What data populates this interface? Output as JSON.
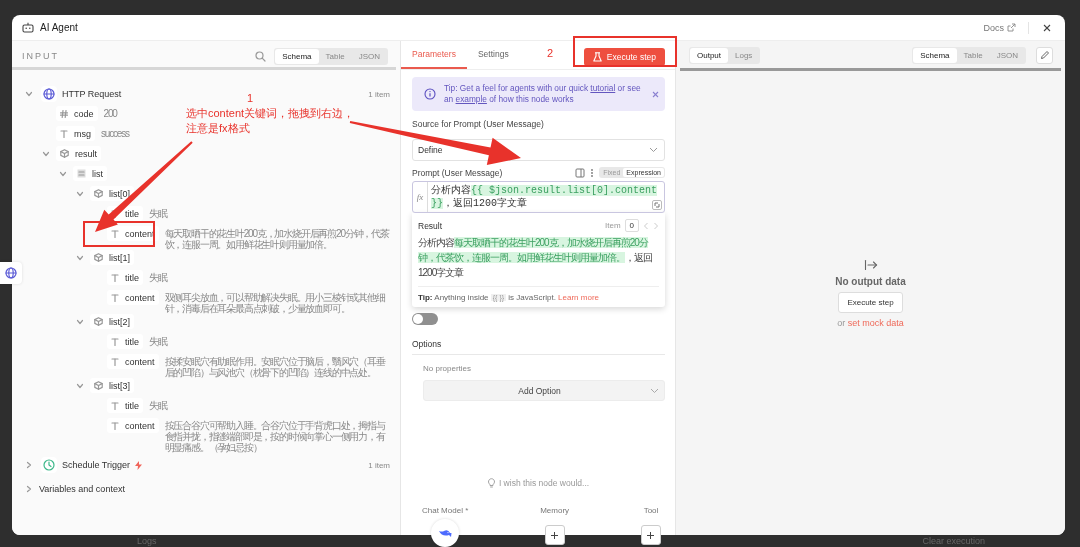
{
  "window": {
    "title": "AI Agent",
    "docs": "Docs"
  },
  "input_panel": {
    "title": "INPUT",
    "view_tabs": [
      {
        "label": "Schema",
        "selected": true
      },
      {
        "label": "Table",
        "selected": false
      },
      {
        "label": "JSON",
        "selected": false
      }
    ],
    "tree": [
      {
        "label": "HTTP Request",
        "kind": "globe",
        "count": "1 item",
        "expanded": true,
        "trigger": false,
        "children": [
          {
            "key": "code",
            "kind": "number",
            "value": "200"
          },
          {
            "key": "msg",
            "kind": "string",
            "value": "success"
          },
          {
            "key": "result",
            "kind": "object",
            "expanded": true,
            "children": [
              {
                "key": "list",
                "kind": "array",
                "expanded": true,
                "children": [
                  {
                    "key": "list[0]",
                    "kind": "object",
                    "expanded": true,
                    "children": [
                      {
                        "key": "title",
                        "kind": "string",
                        "value": "失眠"
                      },
                      {
                        "key": "content",
                        "kind": "string",
                        "value": "每天取晒干的花生叶200克，加水烧开后再煎20分钟，代茶饮，连服一周。如用鲜花生叶则用量加倍。"
                      }
                    ]
                  },
                  {
                    "key": "list[1]",
                    "kind": "object",
                    "expanded": true,
                    "children": [
                      {
                        "key": "title",
                        "kind": "string",
                        "value": "失眠"
                      },
                      {
                        "key": "content",
                        "kind": "string",
                        "value": "双侧耳尖放血，可以帮助解决失眠。用小三棱针或其他细针，消毒后在耳朵最高点刺破，少量放血即可。"
                      }
                    ]
                  },
                  {
                    "key": "list[2]",
                    "kind": "object",
                    "expanded": true,
                    "children": [
                      {
                        "key": "title",
                        "kind": "string",
                        "value": "失眠"
                      },
                      {
                        "key": "content",
                        "kind": "string",
                        "value": "按揉安眠穴有助眠作用。安眠穴位于脑后，翳风穴（耳垂后的凹陷）与风池穴（枕骨下的凹陷）连线的中点处。"
                      }
                    ]
                  },
                  {
                    "key": "list[3]",
                    "kind": "object",
                    "expanded": true,
                    "children": [
                      {
                        "key": "title",
                        "kind": "string",
                        "value": "失眠"
                      },
                      {
                        "key": "content",
                        "kind": "string",
                        "value": "按压合谷穴可帮助入睡。合谷穴位于手背虎口处，拇指与食指并拢，指缝端部即是，按的时候向掌心一侧用力，有明显痛感。（孕妇忌按）"
                      }
                    ]
                  }
                ]
              }
            ]
          }
        ]
      },
      {
        "label": "Schedule Trigger",
        "kind": "clock",
        "count": "1 item",
        "expanded": false,
        "trigger": true
      },
      {
        "label": "Variables and context",
        "kind": "plain",
        "expanded": false,
        "trigger": false
      }
    ]
  },
  "parameters": {
    "tabs": [
      {
        "label": "Parameters",
        "selected": true
      },
      {
        "label": "Settings",
        "selected": false
      }
    ],
    "execute_button": "Execute step",
    "tip": [
      {
        "kind": "plain",
        "text": "Tip: Get a feel for agents with our quick "
      },
      {
        "kind": "link",
        "text": "tutorial"
      },
      {
        "kind": "plain",
        "text": " or see an "
      },
      {
        "kind": "link",
        "text": "example"
      },
      {
        "kind": "plain",
        "text": " of how this node works"
      }
    ],
    "source_label": "Source for Prompt (User Message)",
    "source_value": "Define",
    "prompt_label": "Prompt (User Message)",
    "mode_tabs": [
      {
        "label": "Fixed",
        "selected": false
      },
      {
        "label": "Expression",
        "selected": true
      }
    ],
    "fx_label": "fx",
    "expression": [
      {
        "kind": "plain",
        "text": "分析内容"
      },
      {
        "kind": "highlight",
        "text": "{{ $json.result.list[0].content }}"
      },
      {
        "kind": "plain",
        "text": "，返回1200字文章"
      }
    ],
    "result": {
      "title": "Result",
      "item_label": "Item",
      "item_value": "0",
      "parts": [
        {
          "kind": "plain",
          "text": "分析内容"
        },
        {
          "kind": "highlight",
          "text": "每天取晒干的花生叶200克，加水烧开后再煎20分钟，代茶饮，连服一周。如用鲜花生叶则用量加倍。"
        },
        {
          "kind": "plain",
          "text": "，返回1200字文章"
        }
      ],
      "tip": [
        {
          "kind": "bold",
          "text": "Tip:"
        },
        {
          "kind": "plain",
          "text": " Anything inside "
        },
        {
          "kind": "code",
          "text": "{{ }}"
        },
        {
          "kind": "plain",
          "text": " is JavaScript. "
        },
        {
          "kind": "link",
          "text": "Learn more"
        }
      ]
    },
    "toggle": {
      "on": false
    },
    "options": {
      "title": "Options",
      "empty": "No properties",
      "add_button": "Add Option"
    },
    "feedback": "I wish this node would...",
    "connections": [
      {
        "label": "Chat Model *",
        "kind": "model"
      },
      {
        "label": "Memory",
        "kind": "add"
      },
      {
        "label": "Tool",
        "kind": "add"
      }
    ]
  },
  "output_panel": {
    "tabs": [
      {
        "label": "Output",
        "selected": true
      },
      {
        "label": "Logs",
        "selected": false
      }
    ],
    "view_tabs": [
      {
        "label": "Schema",
        "selected": true
      },
      {
        "label": "Table",
        "selected": false
      },
      {
        "label": "JSON",
        "selected": false
      }
    ],
    "empty_title": "No output data",
    "execute_button": "Execute step",
    "or_text": "or",
    "mock_link": "set mock data"
  },
  "background": {
    "logs_tab": "Logs",
    "clear_button": "Clear execution"
  },
  "annotations": [
    {
      "text": "1"
    },
    {
      "text": "选中content关键词，拖拽到右边，注意是fx格式"
    },
    {
      "text": "2"
    }
  ]
}
